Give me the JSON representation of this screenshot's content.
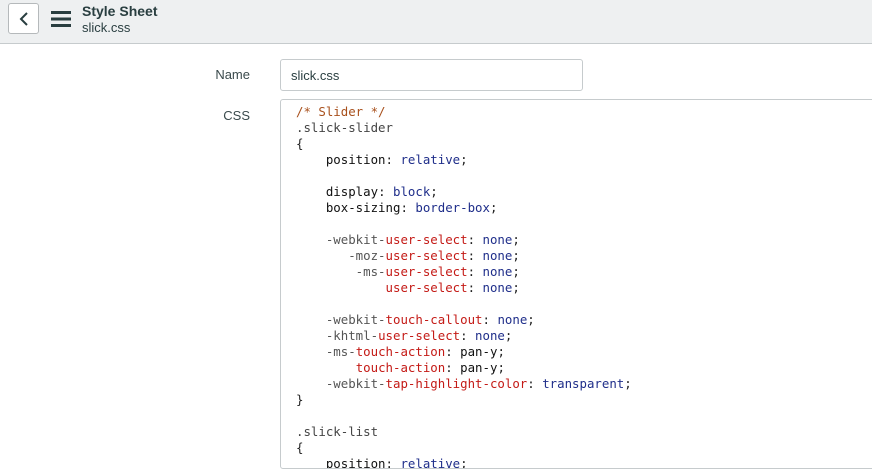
{
  "header": {
    "title": "Style Sheet",
    "subtitle": "slick.css",
    "back_icon": "chevron-left-icon",
    "menu_icon": "hamburger-menu-icon"
  },
  "form": {
    "name_label": "Name",
    "name_value": "slick.css",
    "css_label": "CSS"
  },
  "code_lines": [
    [
      {
        "t": "/* Slider */",
        "c": "comment"
      }
    ],
    [
      {
        "t": ".slick-slider",
        "c": "sel"
      }
    ],
    [
      {
        "t": "{",
        "c": "punc"
      }
    ],
    [
      {
        "t": "    position",
        "c": "prop"
      },
      {
        "t": ": ",
        "c": "punc"
      },
      {
        "t": "relative",
        "c": "val"
      },
      {
        "t": ";",
        "c": "punc"
      }
    ],
    [],
    [
      {
        "t": "    display",
        "c": "prop"
      },
      {
        "t": ": ",
        "c": "punc"
      },
      {
        "t": "block",
        "c": "val"
      },
      {
        "t": ";",
        "c": "punc"
      }
    ],
    [
      {
        "t": "    box-sizing",
        "c": "prop"
      },
      {
        "t": ": ",
        "c": "punc"
      },
      {
        "t": "border-box",
        "c": "val"
      },
      {
        "t": ";",
        "c": "punc"
      }
    ],
    [],
    [
      {
        "t": "    -webkit-",
        "c": "pre"
      },
      {
        "t": "user-select",
        "c": "key"
      },
      {
        "t": ": ",
        "c": "punc"
      },
      {
        "t": "none",
        "c": "val"
      },
      {
        "t": ";",
        "c": "punc"
      }
    ],
    [
      {
        "t": "       -moz-",
        "c": "pre"
      },
      {
        "t": "user-select",
        "c": "key"
      },
      {
        "t": ": ",
        "c": "punc"
      },
      {
        "t": "none",
        "c": "val"
      },
      {
        "t": ";",
        "c": "punc"
      }
    ],
    [
      {
        "t": "        -ms-",
        "c": "pre"
      },
      {
        "t": "user-select",
        "c": "key"
      },
      {
        "t": ": ",
        "c": "punc"
      },
      {
        "t": "none",
        "c": "val"
      },
      {
        "t": ";",
        "c": "punc"
      }
    ],
    [
      {
        "t": "            ",
        "c": "pre"
      },
      {
        "t": "user-select",
        "c": "key"
      },
      {
        "t": ": ",
        "c": "punc"
      },
      {
        "t": "none",
        "c": "val"
      },
      {
        "t": ";",
        "c": "punc"
      }
    ],
    [],
    [
      {
        "t": "    -webkit-",
        "c": "pre"
      },
      {
        "t": "touch-callout",
        "c": "key"
      },
      {
        "t": ": ",
        "c": "punc"
      },
      {
        "t": "none",
        "c": "val"
      },
      {
        "t": ";",
        "c": "punc"
      }
    ],
    [
      {
        "t": "    -khtml-",
        "c": "pre"
      },
      {
        "t": "user-select",
        "c": "key"
      },
      {
        "t": ": ",
        "c": "punc"
      },
      {
        "t": "none",
        "c": "val"
      },
      {
        "t": ";",
        "c": "punc"
      }
    ],
    [
      {
        "t": "    -ms-",
        "c": "pre"
      },
      {
        "t": "touch-action",
        "c": "key"
      },
      {
        "t": ": ",
        "c": "punc"
      },
      {
        "t": "pan-y",
        "c": "prop"
      },
      {
        "t": ";",
        "c": "punc"
      }
    ],
    [
      {
        "t": "        ",
        "c": "pre"
      },
      {
        "t": "touch-action",
        "c": "key"
      },
      {
        "t": ": ",
        "c": "punc"
      },
      {
        "t": "pan-y",
        "c": "prop"
      },
      {
        "t": ";",
        "c": "punc"
      }
    ],
    [
      {
        "t": "    -webkit-",
        "c": "pre"
      },
      {
        "t": "tap-highlight-color",
        "c": "key"
      },
      {
        "t": ": ",
        "c": "punc"
      },
      {
        "t": "transparent",
        "c": "val"
      },
      {
        "t": ";",
        "c": "punc"
      }
    ],
    [
      {
        "t": "}",
        "c": "punc"
      }
    ],
    [],
    [
      {
        "t": ".slick-list",
        "c": "sel"
      }
    ],
    [
      {
        "t": "{",
        "c": "punc"
      }
    ],
    [
      {
        "t": "    position",
        "c": "prop"
      },
      {
        "t": ": ",
        "c": "punc"
      },
      {
        "t": "relative",
        "c": "val"
      },
      {
        "t": ";",
        "c": "punc"
      }
    ]
  ]
}
